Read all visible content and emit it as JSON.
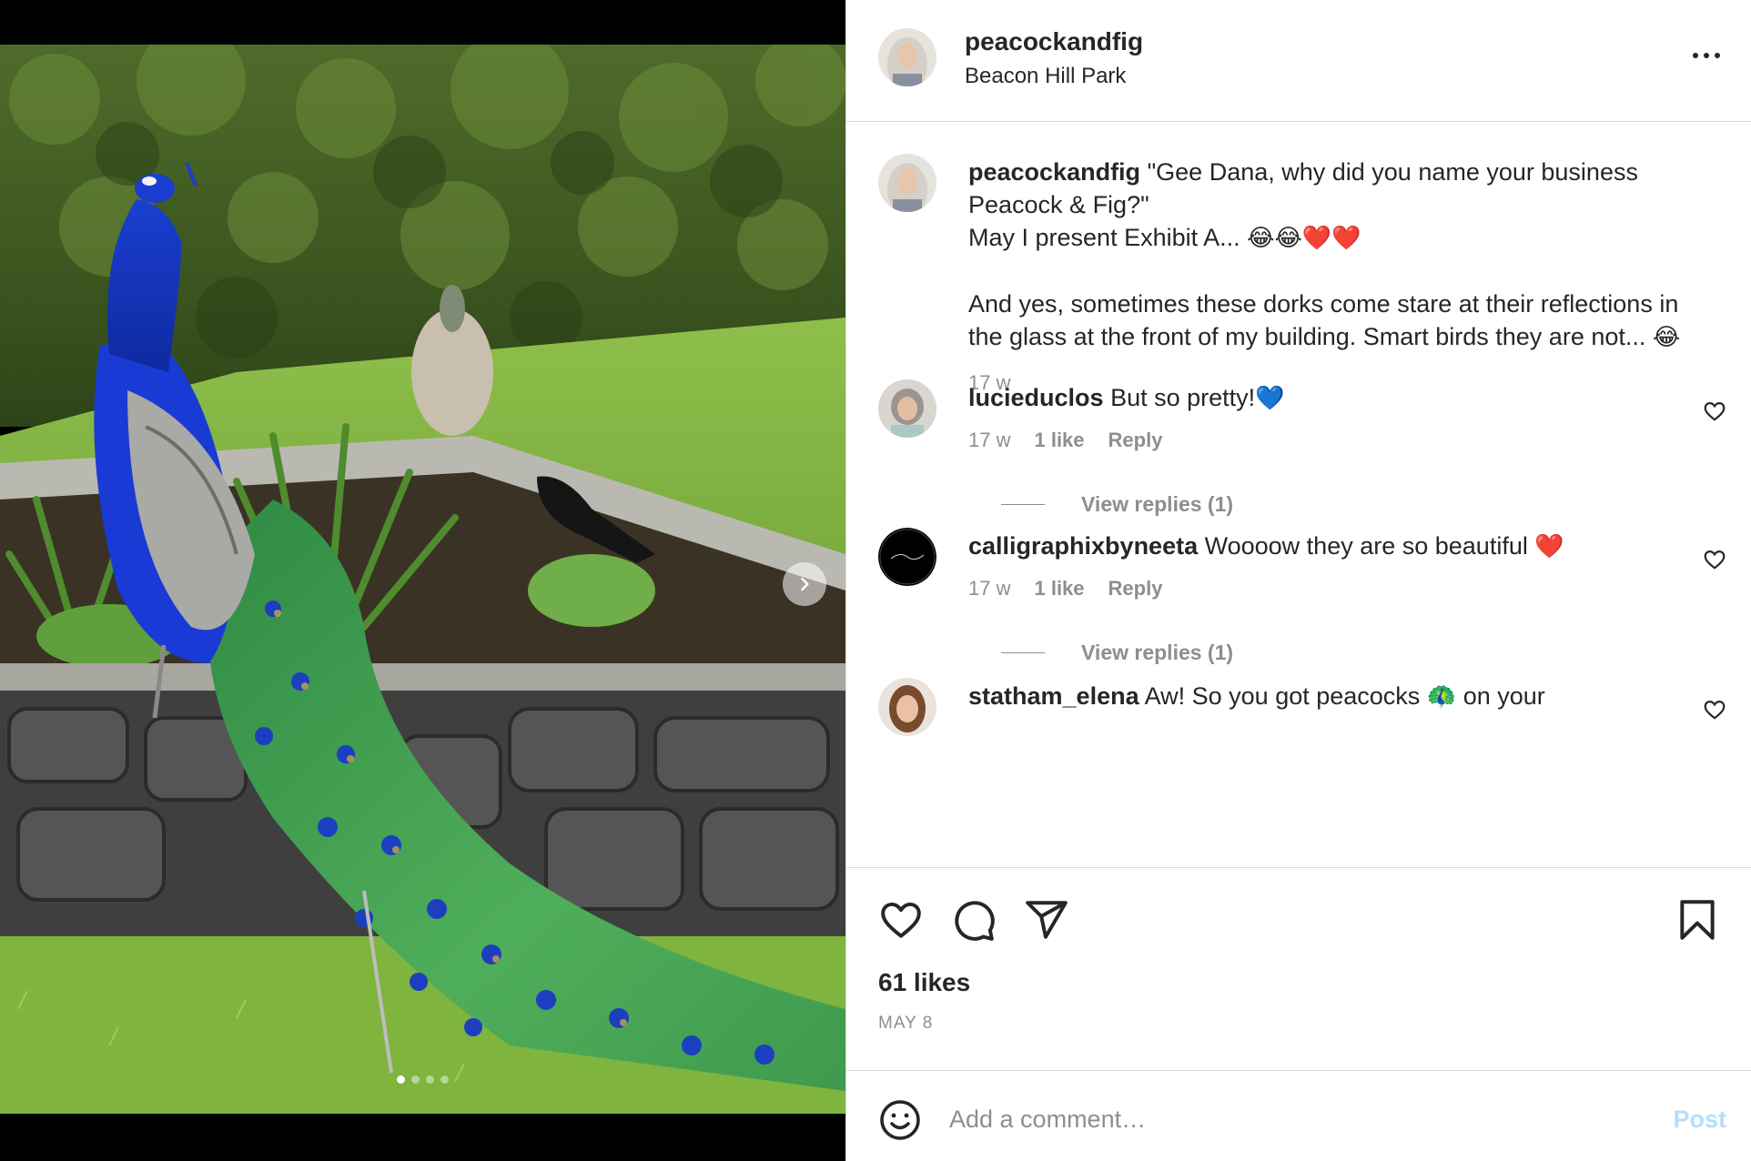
{
  "post": {
    "username": "peacockandfig",
    "location": "Beacon Hill Park",
    "more_icon": "more-horizontal-icon"
  },
  "media": {
    "carousel_dots": 4,
    "active_dot": 0,
    "next_icon": "chevron-right-icon",
    "alt": "Peacock with long tail on a stone wall in a park, peahen and crow behind"
  },
  "caption": {
    "username": "peacockandfig",
    "text_1": "\"Gee Dana, why did you name your business Peacock & Fig?\"",
    "text_2": "May I present Exhibit A...",
    "emoji_2": "😂😂❤️❤️",
    "text_3": "And yes, sometimes these dorks come stare at their reflections in the glass at the front of my building. Smart birds they are not...",
    "emoji_3": "😂",
    "time": "17 w"
  },
  "comments": [
    {
      "username": "lucieduclos",
      "text": "But so pretty!",
      "emoji": "💙",
      "time": "17 w",
      "likes": "1 like",
      "reply": "Reply",
      "view_replies": "View replies (1)"
    },
    {
      "username": "calligraphixbyneeta",
      "text": "Woooow they are so beautiful",
      "emoji": "❤️",
      "time": "17 w",
      "likes": "1 like",
      "reply": "Reply",
      "view_replies": "View replies (1)"
    },
    {
      "username": "statham_elena",
      "text": "Aw! So you got peacocks",
      "emoji": "🦚",
      "text_after": "on your"
    }
  ],
  "actions": {
    "like_icon": "heart-icon",
    "comment_icon": "comment-icon",
    "share_icon": "paper-plane-icon",
    "save_icon": "bookmark-icon",
    "likes_count": "61 likes",
    "date": "MAY 8"
  },
  "comment_box": {
    "emoji_icon": "smiley-icon",
    "placeholder": "Add a comment…",
    "post_label": "Post"
  },
  "colors": {
    "text": "#262626",
    "muted": "#8e8e8e",
    "border": "#dbdbdb",
    "post_disabled": "#b2dffc"
  }
}
